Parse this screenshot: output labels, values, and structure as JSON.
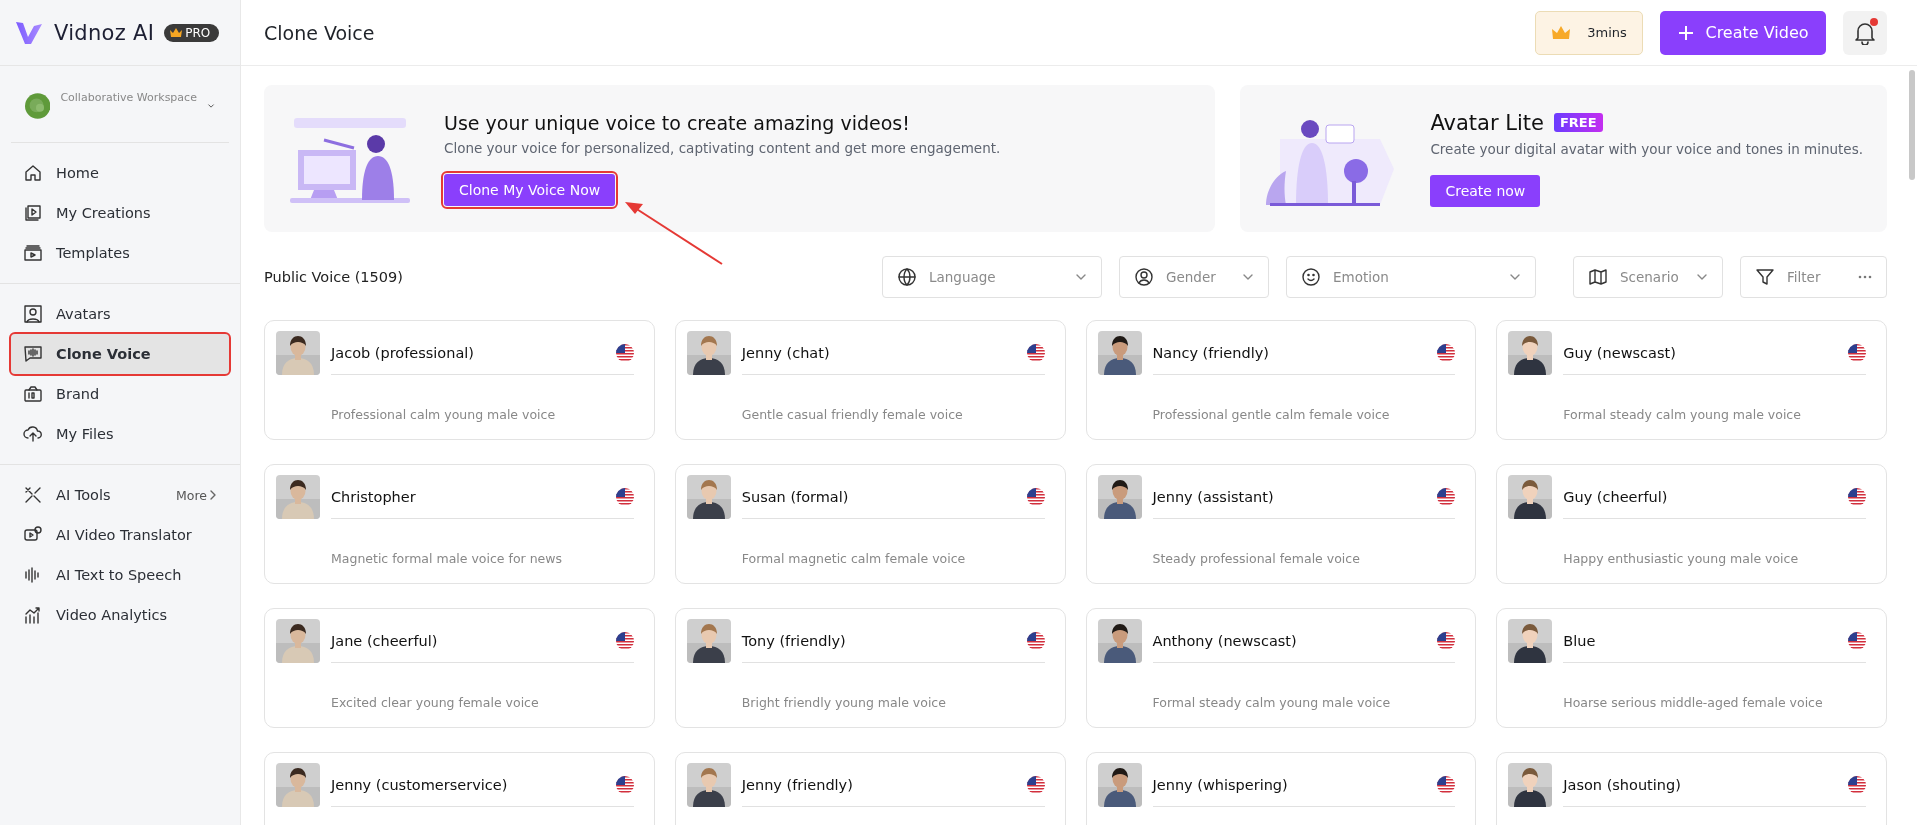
{
  "sidebar": {
    "brand": "Vidnoz AI",
    "plan_badge": "PRO",
    "workspace": {
      "label": "Collaborative Workspace"
    },
    "groups": [
      {
        "items": [
          {
            "label": "Home",
            "selected": false,
            "highlighted": false
          },
          {
            "label": "My Creations",
            "selected": false,
            "highlighted": false
          },
          {
            "label": "Templates",
            "selected": false,
            "highlighted": false
          }
        ]
      },
      {
        "items": [
          {
            "label": "Avatars",
            "selected": false,
            "highlighted": false
          },
          {
            "label": "Clone Voice",
            "selected": true,
            "highlighted": true
          },
          {
            "label": "Brand",
            "selected": false,
            "highlighted": false
          },
          {
            "label": "My Files",
            "selected": false,
            "highlighted": false
          }
        ]
      },
      {
        "items": [
          {
            "label": "AI Tools",
            "selected": false,
            "highlighted": false,
            "more": "More"
          },
          {
            "label": "AI Video Translator",
            "selected": false,
            "highlighted": false
          },
          {
            "label": "AI Text to Speech",
            "selected": false,
            "highlighted": false
          },
          {
            "label": "Video Analytics",
            "selected": false,
            "highlighted": false
          }
        ]
      }
    ]
  },
  "header": {
    "title": "Clone Voice",
    "credits": "3mins",
    "create_button": "Create Video",
    "notifications": {
      "unread": true
    }
  },
  "banners": [
    {
      "title": "Use your unique voice to create amazing videos!",
      "description": "Clone your voice for personalized, captivating content and get more engagement.",
      "button": {
        "label": "Clone My Voice Now",
        "highlighted": true
      }
    },
    {
      "title": "Avatar Lite",
      "badge": "FREE",
      "description": "Create your digital avatar with your voice and tones in minutes.",
      "button": {
        "label": "Create now",
        "highlighted": false
      }
    }
  ],
  "voices": {
    "title": "Public Voice (1509)",
    "filters": [
      {
        "kind": "dropdown",
        "placeholder": "Language"
      },
      {
        "kind": "dropdown",
        "placeholder": "Gender"
      },
      {
        "kind": "dropdown",
        "placeholder": "Emotion"
      },
      {
        "kind": "dropdown",
        "placeholder": "Scenario"
      },
      {
        "kind": "more",
        "placeholder": "Filter"
      }
    ],
    "cards": [
      {
        "name": "Jacob (professional)",
        "description": "Professional calm young male voice"
      },
      {
        "name": "Jenny (chat)",
        "description": "Gentle casual friendly female voice"
      },
      {
        "name": "Nancy (friendly)",
        "description": "Professional gentle calm female voice"
      },
      {
        "name": "Guy (newscast)",
        "description": "Formal steady calm young male voice"
      },
      {
        "name": "Christopher",
        "description": "Magnetic formal male voice for news"
      },
      {
        "name": "Susan (formal)",
        "description": "Formal magnetic calm female voice"
      },
      {
        "name": "Jenny (assistant)",
        "description": "Steady professional female voice"
      },
      {
        "name": "Guy (cheerful)",
        "description": "Happy enthusiastic young male voice"
      },
      {
        "name": "Jane (cheerful)",
        "description": "Excited clear young female voice"
      },
      {
        "name": "Tony (friendly)",
        "description": "Bright friendly young male voice"
      },
      {
        "name": "Anthony (newscast)",
        "description": "Formal steady calm young male voice"
      },
      {
        "name": "Blue",
        "description": "Hoarse serious middle-aged female voice"
      },
      {
        "name": "Jenny (customerservice)"
      },
      {
        "name": "Jenny (friendly)"
      },
      {
        "name": "Jenny (whispering)"
      },
      {
        "name": "Jason (shouting)"
      }
    ]
  }
}
